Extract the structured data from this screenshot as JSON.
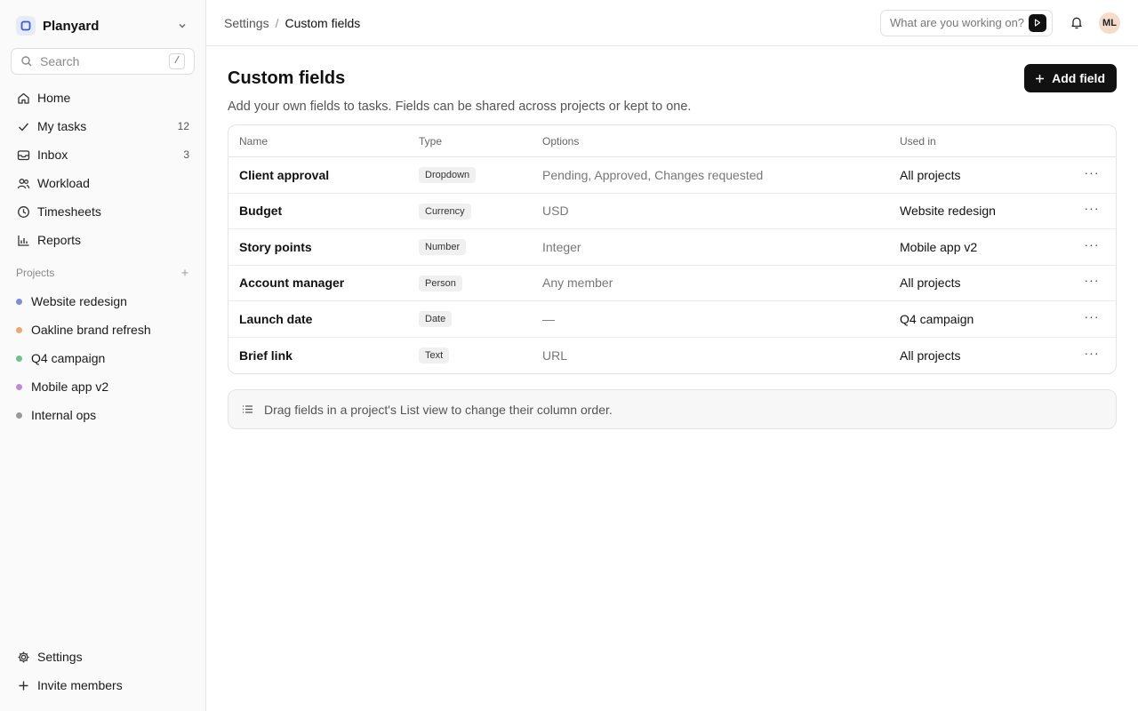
{
  "workspace": {
    "name": "Planyard"
  },
  "search": {
    "placeholder": "Search",
    "shortcut": "/"
  },
  "nav": [
    {
      "label": "Home",
      "icon": "home-icon",
      "count": ""
    },
    {
      "label": "My tasks",
      "icon": "check-icon",
      "count": "12"
    },
    {
      "label": "Inbox",
      "icon": "inbox-icon",
      "count": "3"
    },
    {
      "label": "Workload",
      "icon": "users-icon",
      "count": ""
    },
    {
      "label": "Timesheets",
      "icon": "clock-icon",
      "count": ""
    },
    {
      "label": "Reports",
      "icon": "bar-chart-icon",
      "count": ""
    }
  ],
  "projects": {
    "heading": "Projects",
    "items": [
      {
        "label": "Website redesign",
        "color": "#7b8fe0"
      },
      {
        "label": "Oakline brand refresh",
        "color": "#f0a66d"
      },
      {
        "label": "Q4 campaign",
        "color": "#6cc38b"
      },
      {
        "label": "Mobile app v2",
        "color": "#c08ad8"
      },
      {
        "label": "Internal ops",
        "color": "#9a9a9a"
      }
    ]
  },
  "bottom_nav": [
    {
      "label": "Settings",
      "icon": "gear-icon"
    },
    {
      "label": "Invite members",
      "icon": "plus-icon"
    }
  ],
  "breadcrumb": {
    "parent": "Settings",
    "separator": "/",
    "current": "Custom fields"
  },
  "ask": {
    "placeholder": "What are you working on?"
  },
  "user": {
    "initials": "ML"
  },
  "page": {
    "title": "Custom fields",
    "add_button": "Add field",
    "subtitle": "Add your own fields to tasks. Fields can be shared across projects or kept to one."
  },
  "table": {
    "headers": [
      "Name",
      "Type",
      "Options",
      "Used in"
    ],
    "rows": [
      {
        "name": "Client approval",
        "type": "Dropdown",
        "options": "Pending, Approved, Changes requested",
        "used_in": "All projects"
      },
      {
        "name": "Budget",
        "type": "Currency",
        "options": "USD",
        "used_in": "Website redesign"
      },
      {
        "name": "Story points",
        "type": "Number",
        "options": "Integer",
        "used_in": "Mobile app v2"
      },
      {
        "name": "Account manager",
        "type": "Person",
        "options": "Any member",
        "used_in": "All projects"
      },
      {
        "name": "Launch date",
        "type": "Date",
        "options": "—",
        "used_in": "Q4 campaign"
      },
      {
        "name": "Brief link",
        "type": "Text",
        "options": "URL",
        "used_in": "All projects"
      }
    ]
  },
  "hint": {
    "text": "Drag fields in a project's List view to change their column order."
  }
}
